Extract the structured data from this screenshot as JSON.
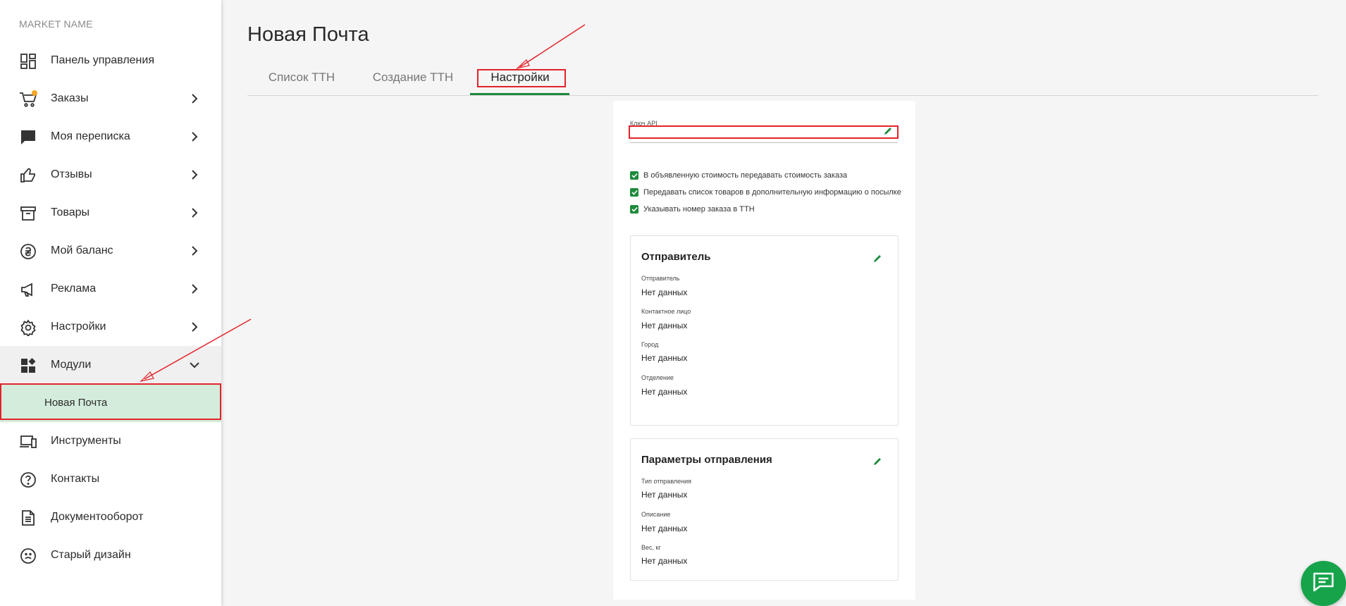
{
  "sidebar": {
    "market_name": "MARKET NAME",
    "items": [
      {
        "label": "Панель управления",
        "icon": "dashboard-icon",
        "chevron": false
      },
      {
        "label": "Заказы",
        "icon": "cart-icon",
        "chevron": true,
        "badge": "orange"
      },
      {
        "label": "Моя переписка",
        "icon": "chat-bubble-icon",
        "chevron": true
      },
      {
        "label": "Отзывы",
        "icon": "thumbs-up-icon",
        "chevron": true
      },
      {
        "label": "Товары",
        "icon": "archive-box-icon",
        "chevron": true
      },
      {
        "label": "Мой баланс",
        "icon": "hryvnia-coin-icon",
        "chevron": true
      },
      {
        "label": "Реклама",
        "icon": "megaphone-icon",
        "chevron": true
      },
      {
        "label": "Настройки",
        "icon": "gear-icon",
        "chevron": true
      },
      {
        "label": "Модули",
        "icon": "modules-icon",
        "chevron": true,
        "expanded": true
      },
      {
        "label": "Инструменты",
        "icon": "devices-icon",
        "chevron": false
      },
      {
        "label": "Контакты",
        "icon": "help-circle-icon",
        "chevron": false
      },
      {
        "label": "Документооборот",
        "icon": "document-icon",
        "chevron": false
      },
      {
        "label": "Старый дизайн",
        "icon": "sad-face-icon",
        "chevron": false
      }
    ],
    "submenu": {
      "label": "Новая Почта"
    }
  },
  "page": {
    "title": "Новая Почта"
  },
  "tabs": [
    {
      "label": "Список ТТН",
      "active": false
    },
    {
      "label": "Создание ТТН",
      "active": false
    },
    {
      "label": "Настройки",
      "active": true
    }
  ],
  "settings": {
    "api_key_label": "Ключ API",
    "api_key_value": "",
    "checkboxes": [
      {
        "label": "В объявленную стоимость передавать стоимость заказа",
        "checked": true
      },
      {
        "label": "Передавать список товаров в дополнительную информацию о посылке",
        "checked": true
      },
      {
        "label": "Указывать номер заказа в ТТН",
        "checked": true
      }
    ],
    "sender_card": {
      "title": "Отправитель",
      "fields": [
        {
          "label": "Отправитель",
          "value": "Нет данных"
        },
        {
          "label": "Контактное лицо",
          "value": "Нет данных"
        },
        {
          "label": "Город",
          "value": "Нет данных"
        },
        {
          "label": "Отделение",
          "value": "Нет данных"
        }
      ]
    },
    "shipping_card": {
      "title": "Параметры отправления",
      "fields": [
        {
          "label": "Тип отправления",
          "value": "Нет данных"
        },
        {
          "label": "Описание",
          "value": "Нет данных"
        },
        {
          "label": "Вес, кг",
          "value": "Нет данных"
        }
      ]
    }
  },
  "colors": {
    "accent": "#1e8a3c",
    "highlight": "#e3232b",
    "submenu_bg": "#d4ecdb",
    "chat_button": "#16a34a"
  }
}
